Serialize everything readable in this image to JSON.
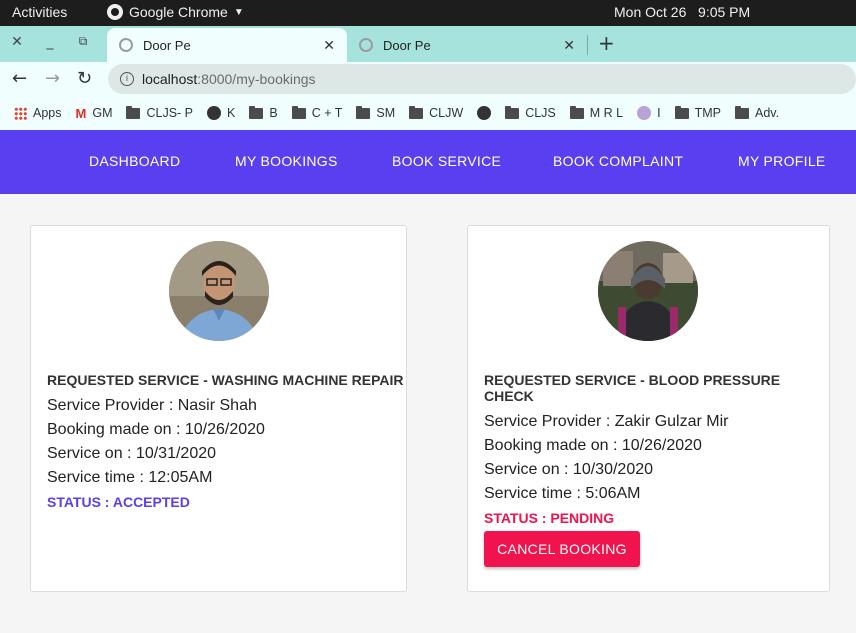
{
  "system": {
    "activities": "Activities",
    "app_name": "Google Chrome",
    "clock": "Mon Oct 26   9:05 PM"
  },
  "browser": {
    "tabs": [
      {
        "title": "Door Pe"
      },
      {
        "title": "Door Pe"
      }
    ],
    "url_host": "localhost",
    "url_path": ":8000/my-bookings",
    "bookmarks": [
      {
        "label": "Apps",
        "icon": "apps-icon"
      },
      {
        "label": "GM",
        "icon": "gmail-icon"
      },
      {
        "label": "CLJS- P",
        "icon": "folder-icon"
      },
      {
        "label": "K",
        "icon": "globe-icon"
      },
      {
        "label": "B",
        "icon": "folder-icon"
      },
      {
        "label": "C + T",
        "icon": "folder-icon"
      },
      {
        "label": "SM",
        "icon": "folder-icon"
      },
      {
        "label": "CLJW",
        "icon": "folder-icon"
      },
      {
        "label": "",
        "icon": "globe-icon"
      },
      {
        "label": "CLJS",
        "icon": "folder-icon"
      },
      {
        "label": "M R L",
        "icon": "folder-icon"
      },
      {
        "label": "I",
        "icon": "mu-icon"
      },
      {
        "label": "TMP",
        "icon": "folder-icon"
      },
      {
        "label": "Adv.",
        "icon": "folder-icon"
      }
    ]
  },
  "nav": {
    "dashboard": "DASHBOARD",
    "my_bookings": "MY BOOKINGS",
    "book_service": "BOOK SERVICE",
    "book_complaint": "BOOK COMPLAINT",
    "my_profile": "MY PROFILE"
  },
  "bookings": [
    {
      "requested": "REQUESTED SERVICE - WASHING MACHINE REPAIR",
      "provider": "Service Provider : Nasir Shah",
      "booked": "Booking made on : 10/26/2020",
      "service_on": "Service on : 10/31/2020",
      "time": "Service time : 12:05AM",
      "status": "STATUS : ACCEPTED"
    },
    {
      "requested": "REQUESTED SERVICE - BLOOD PRESSURE CHECK",
      "provider": "Service Provider : Zakir Gulzar Mir",
      "booked": "Booking made on : 10/26/2020",
      "service_on": "Service on : 10/30/2020",
      "time": "Service time : 5:06AM",
      "status": "STATUS : PENDING",
      "action": "CANCEL BOOKING"
    }
  ],
  "colors": {
    "primary": "#5a3ff0",
    "danger": "#f0134d",
    "tab_bar": "#a6e3dd"
  }
}
